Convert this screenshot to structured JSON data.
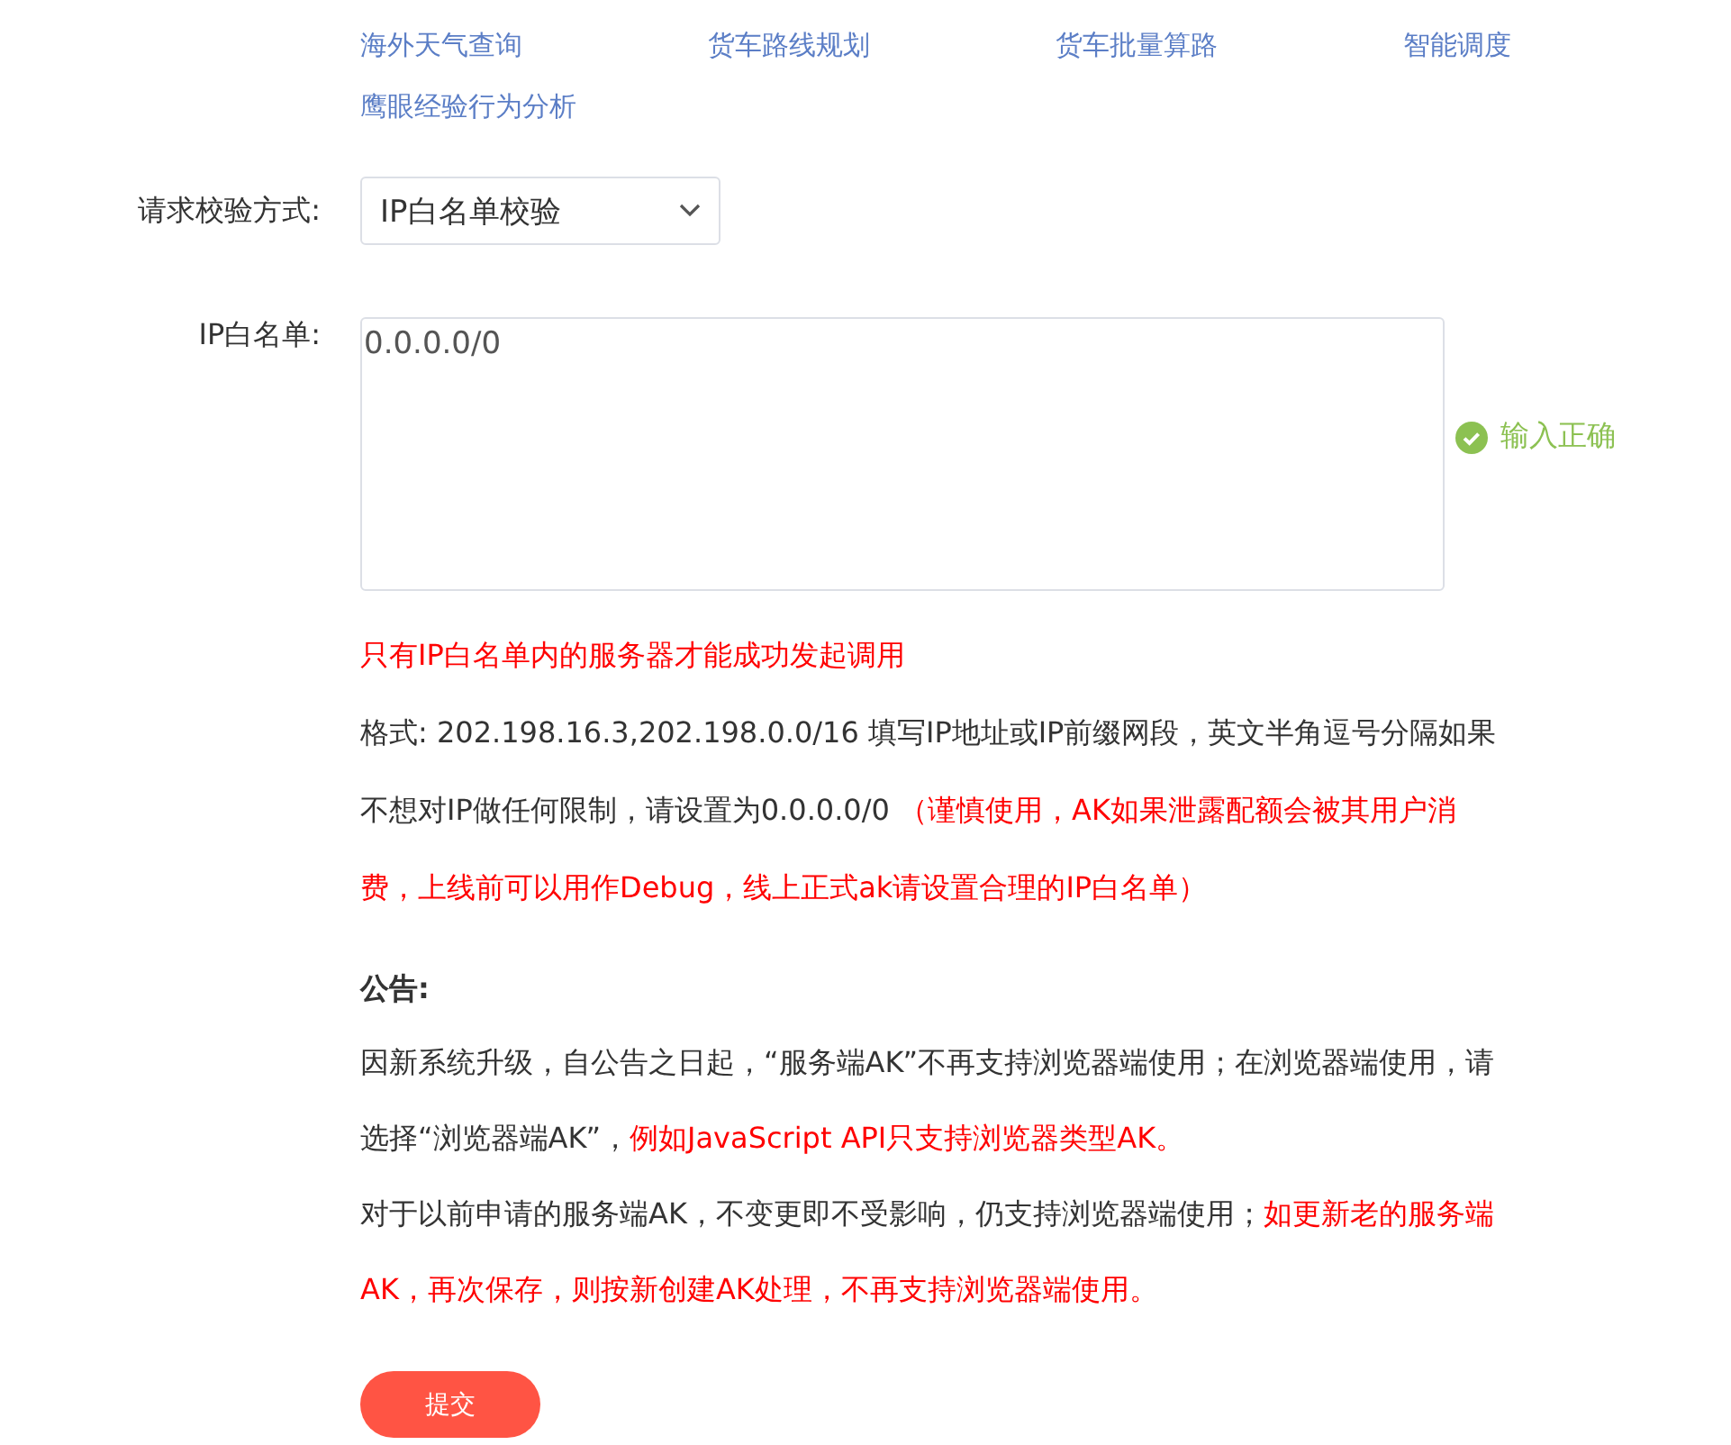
{
  "service_links": [
    {
      "label": "海外天气查询"
    },
    {
      "label": "货车路线规划"
    },
    {
      "label": "货车批量算路"
    },
    {
      "label": "智能调度"
    },
    {
      "label": "鹰眼经验行为分析"
    }
  ],
  "verify_method": {
    "label": "请求校验方式:",
    "value": "IP白名单校验"
  },
  "ip_whitelist": {
    "label": "IP白名单:",
    "value": "0.0.0.0/0",
    "validation": {
      "valid": true,
      "message": "输入正确"
    }
  },
  "hints": [
    {
      "segments": [
        {
          "text": "只有IP白名单内的服务器才能成功发起调用",
          "kind": "warning"
        }
      ]
    },
    {
      "segments": [
        {
          "text": "格式: 202.198.16.3,202.198.0.0/16 填写IP地址或IP前缀网段，英文半角逗号分隔如果不想对IP做任何限制，请设置为0.0.0.0/0 ",
          "kind": "normal"
        },
        {
          "text": "（谨慎使用，AK如果泄露配额会被其用户消费，上线前可以用作Debug，线上正式ak请设置合理的IP白名单）",
          "kind": "warning"
        }
      ]
    }
  ],
  "notice": {
    "title": "公告:",
    "paragraphs": [
      {
        "segments": [
          {
            "text": "因新系统升级，自公告之日起，“服务端AK”不再支持浏览器端使用；在浏览器端使用，请选择“浏览器端AK”，",
            "kind": "normal"
          },
          {
            "text": "例如JavaScript API只支持浏览器类型AK。",
            "kind": "warning"
          }
        ]
      },
      {
        "segments": [
          {
            "text": "对于以前申请的服务端AK，不变更即不受影响，仍支持浏览器端使用；",
            "kind": "normal"
          },
          {
            "text": "如更新老的服务端AK，再次保存，则按新创建AK处理，不再支持浏览器端使用。",
            "kind": "warning"
          }
        ]
      }
    ]
  },
  "submit_button": {
    "label": "提交"
  }
}
